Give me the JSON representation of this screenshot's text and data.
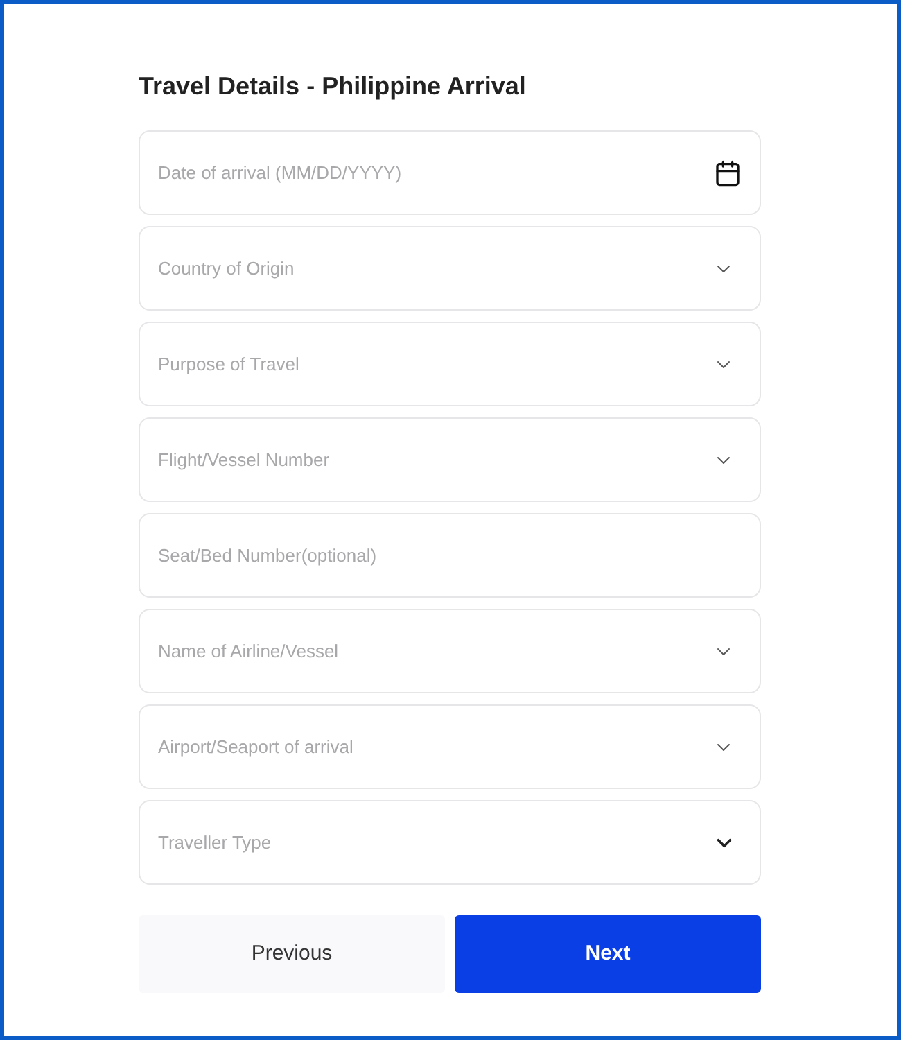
{
  "title": "Travel Details - Philippine Arrival",
  "fields": [
    {
      "kind": "date",
      "placeholder": "Date of arrival (MM/DD/YYYY)"
    },
    {
      "kind": "select",
      "placeholder": "Country of Origin"
    },
    {
      "kind": "select",
      "placeholder": "Purpose of Travel"
    },
    {
      "kind": "select",
      "placeholder": "Flight/Vessel Number"
    },
    {
      "kind": "text",
      "placeholder": "Seat/Bed Number(optional)"
    },
    {
      "kind": "select",
      "placeholder": "Name of Airline/Vessel"
    },
    {
      "kind": "select",
      "placeholder": "Airport/Seaport of arrival"
    },
    {
      "kind": "dropdown",
      "placeholder": "Traveller Type"
    }
  ],
  "buttons": [
    {
      "kind": "secondary",
      "label": "Previous"
    },
    {
      "kind": "primary",
      "label": "Next"
    }
  ]
}
